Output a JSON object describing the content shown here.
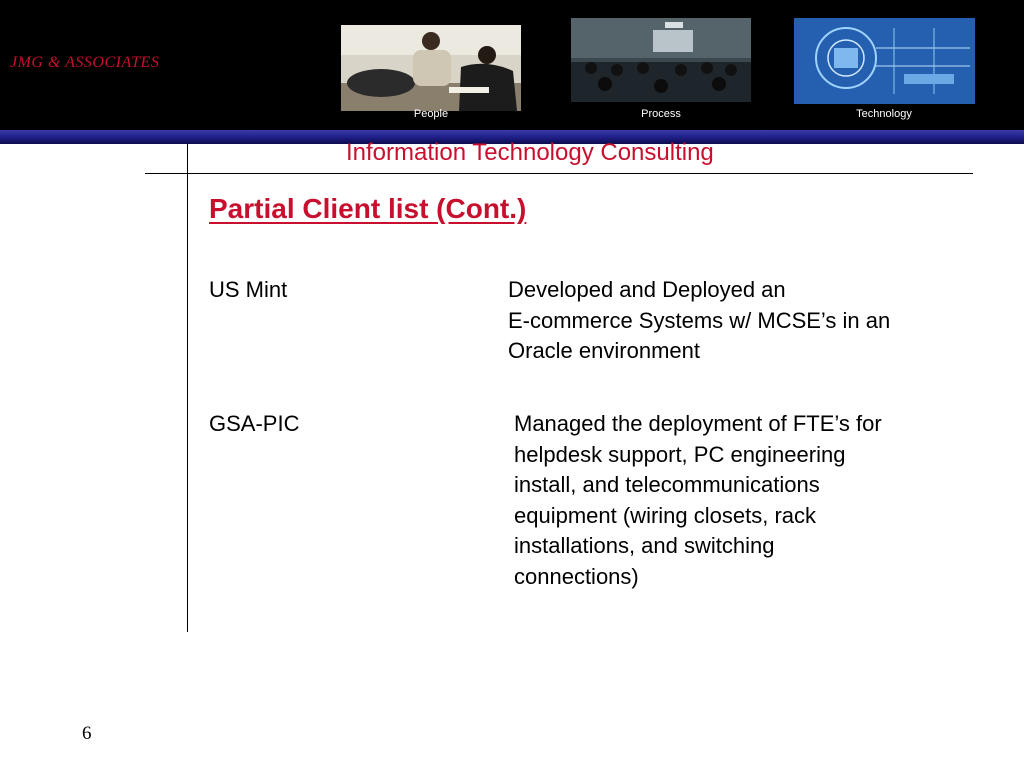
{
  "header": {
    "brand": "JMG & ASSOCIATES",
    "images": [
      {
        "caption": "People",
        "icon": "people-meeting-photo"
      },
      {
        "caption": "Process",
        "icon": "presentation-room-photo"
      },
      {
        "caption": "Technology",
        "icon": "circuit-technology-photo"
      }
    ],
    "subtitle": "Information Technology Consulting"
  },
  "slide": {
    "title": "Partial Client list (Cont.)",
    "clients": [
      {
        "name": "US Mint",
        "description_lines": [
          "Developed and Deployed an",
          "E-commerce Systems w/ MCSE’s in an",
          "Oracle environment"
        ]
      },
      {
        "name": "GSA-PIC",
        "description_lines": [
          "Managed the deployment of FTE’s for",
          "helpdesk support, PC engineering",
          "install, and  telecommunications",
          "equipment (wiring closets, rack",
          "installations, and switching",
          "connections)"
        ]
      }
    ]
  },
  "footer": {
    "page_number": "6"
  },
  "colors": {
    "header_background": "#000000",
    "header_band": "#2a2a96",
    "accent_red": "#c8102e",
    "text": "#000000"
  }
}
